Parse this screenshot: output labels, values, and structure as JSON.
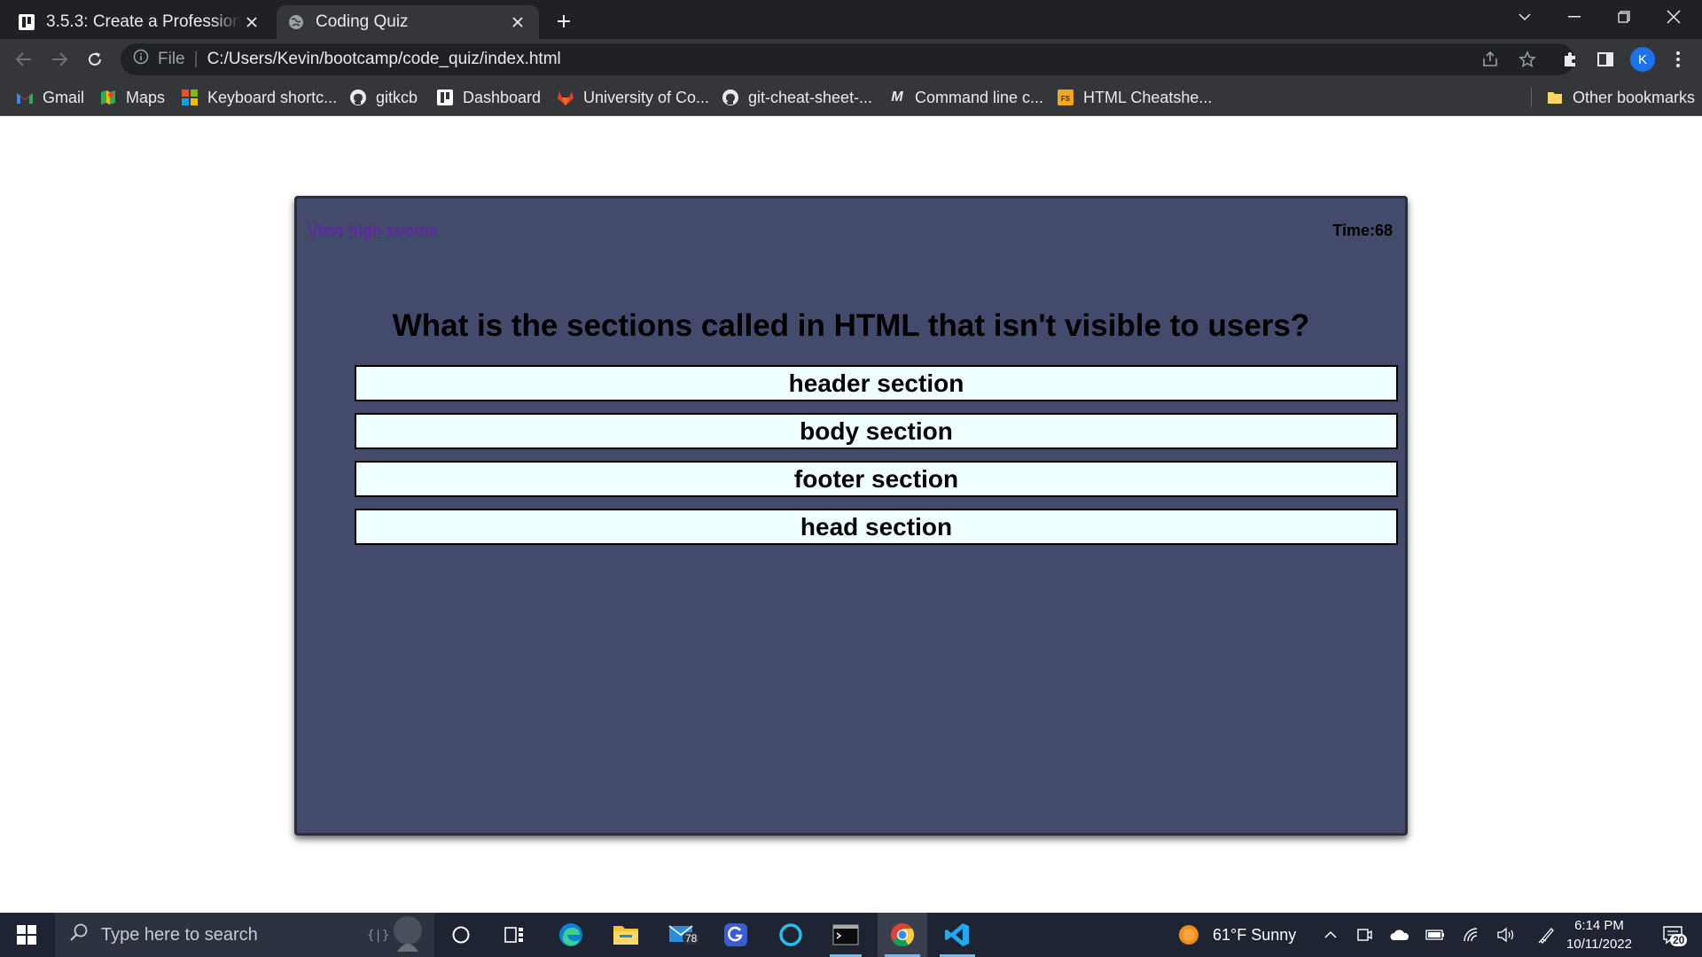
{
  "browser": {
    "tabs": [
      {
        "title": "3.5.3: Create a Professional P",
        "icon": "bootcamp-icon",
        "active": false
      },
      {
        "title": "Coding Quiz",
        "icon": "globe-icon",
        "active": true
      }
    ],
    "address": {
      "scheme": "File",
      "url": "C:/Users/Kevin/bootcamp/code_quiz/index.html"
    },
    "profile_initial": "K",
    "bookmarks": [
      {
        "label": "Gmail",
        "icon": "gmail-icon"
      },
      {
        "label": "Maps",
        "icon": "maps-icon"
      },
      {
        "label": "Keyboard shortc...",
        "icon": "microsoft-icon"
      },
      {
        "label": "gitkcb",
        "icon": "github-icon"
      },
      {
        "label": "Dashboard",
        "icon": "bootcamp-icon"
      },
      {
        "label": "University of Co...",
        "icon": "gitlab-icon"
      },
      {
        "label": "git-cheat-sheet-...",
        "icon": "github-icon"
      },
      {
        "label": "Command line c...",
        "icon": "medium-icon"
      },
      {
        "label": "HTML Cheatshe...",
        "icon": "fs-icon"
      }
    ],
    "other_bookmarks": "Other bookmarks"
  },
  "quiz": {
    "high_scores_link": "View high scores",
    "timer": "Time:68",
    "question": "What is the sections called in HTML that isn't visible to users?",
    "answers": [
      "header section",
      "body section",
      "footer section",
      "head section"
    ],
    "colors": {
      "card": "#434a6b",
      "answer_bg": "#f0ffff",
      "link": "#5b2a9e"
    }
  },
  "taskbar": {
    "search_placeholder": "Type here to search",
    "mail_badge": "78",
    "weather": "61°F  Sunny",
    "time": "6:14 PM",
    "date": "10/11/2022",
    "notification_count": "20"
  }
}
